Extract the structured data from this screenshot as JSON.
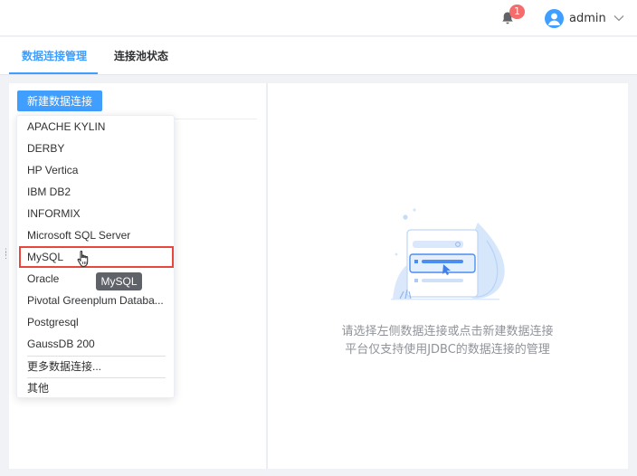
{
  "header": {
    "notification_count": "1",
    "username": "admin"
  },
  "tabs": [
    {
      "label": "数据连接管理",
      "active": true
    },
    {
      "label": "连接池状态",
      "active": false
    }
  ],
  "toolbar": {
    "new_connection_label": "新建数据连接"
  },
  "dropdown": {
    "items": [
      "APACHE KYLIN",
      "DERBY",
      "HP Vertica",
      "IBM DB2",
      "INFORMIX",
      "Microsoft SQL Server",
      "MySQL",
      "Oracle",
      "Pivotal Greenplum Databa...",
      "Postgresql",
      "GaussDB 200",
      "更多数据连接...",
      "其他"
    ],
    "selected": "MySQL",
    "tooltip": "MySQL"
  },
  "empty_state": {
    "line1": "请选择左侧数据连接或点击新建数据连接",
    "line2": "平台仅支持使用JDBC的数据连接的管理"
  },
  "colors": {
    "accent": "#409eff",
    "badge": "#f56c6c",
    "selected_outline": "#e8483b"
  }
}
